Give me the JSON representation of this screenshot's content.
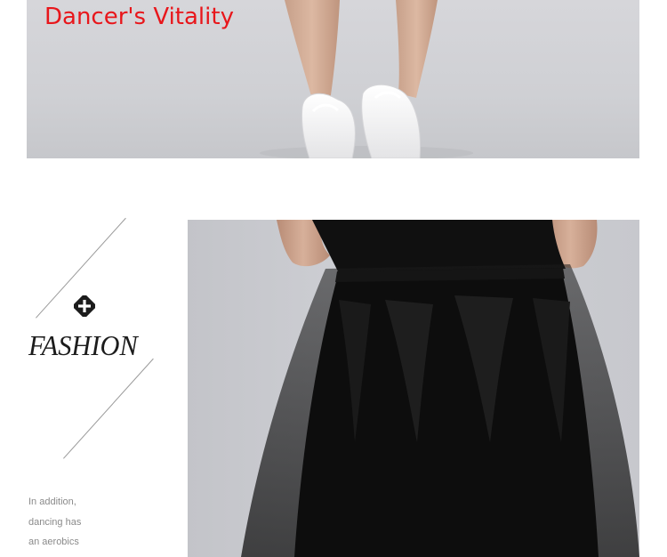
{
  "banner": {
    "caption": "Dancer's Vitality",
    "photo_subject": "legs in white dance shoes",
    "caption_color": "#e8161b"
  },
  "fashion_panel": {
    "icon": "cross-ornament-icon",
    "title": "FASHION",
    "body_lines": [
      "In addition,",
      "dancing has",
      "an aerobics"
    ]
  },
  "product_photo": {
    "subject": "black long tulle ballroom skirt"
  }
}
